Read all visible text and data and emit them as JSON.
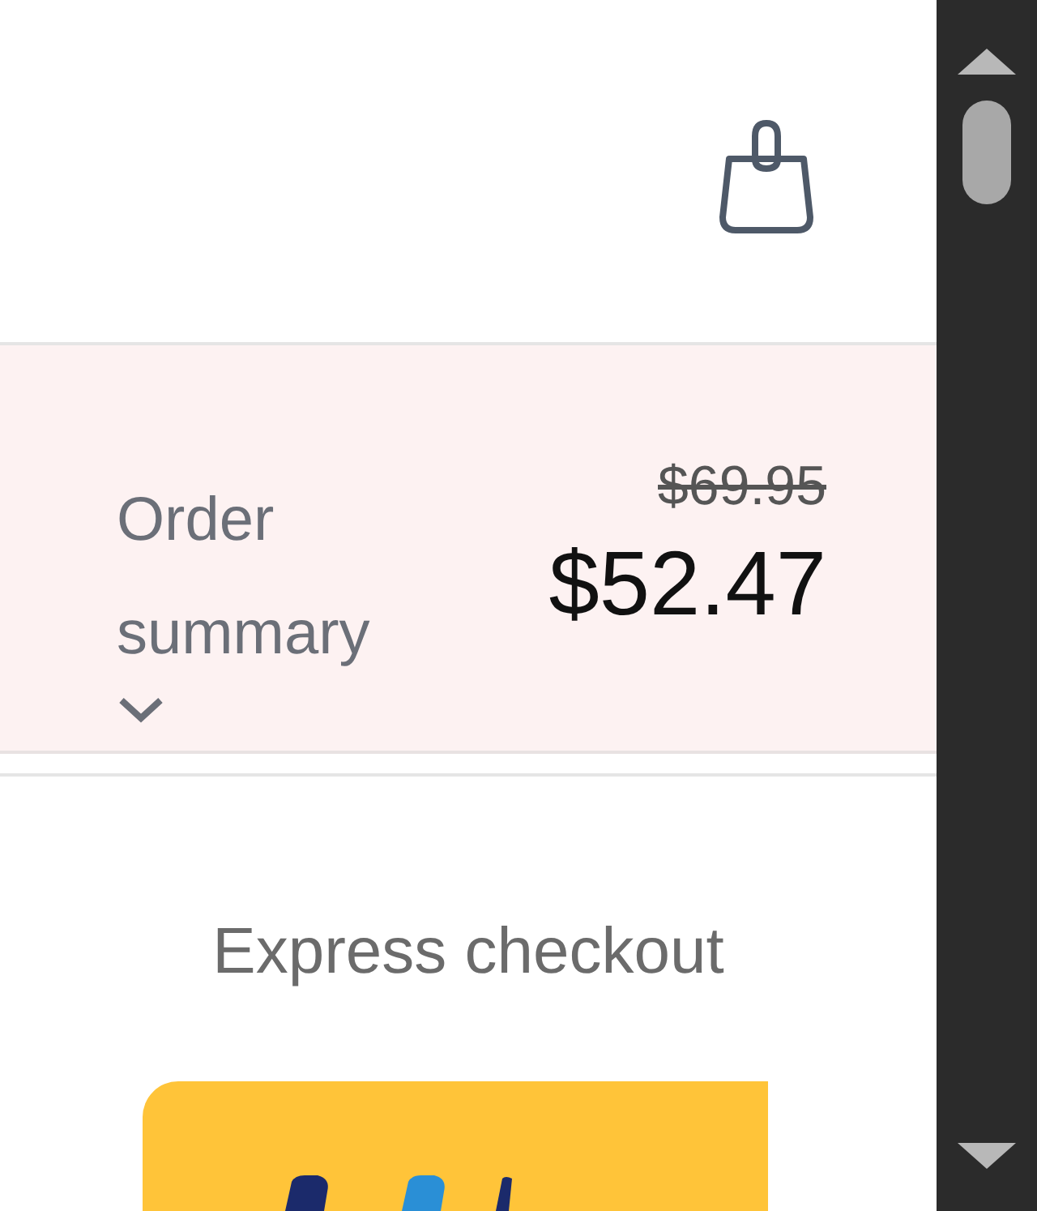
{
  "order_summary": {
    "label": "Order summary",
    "expanded": false,
    "original_price": "$69.95",
    "total": "$52.47"
  },
  "express_checkout": {
    "heading": "Express checkout",
    "buttons": [
      {
        "kind": "paypal"
      }
    ]
  }
}
